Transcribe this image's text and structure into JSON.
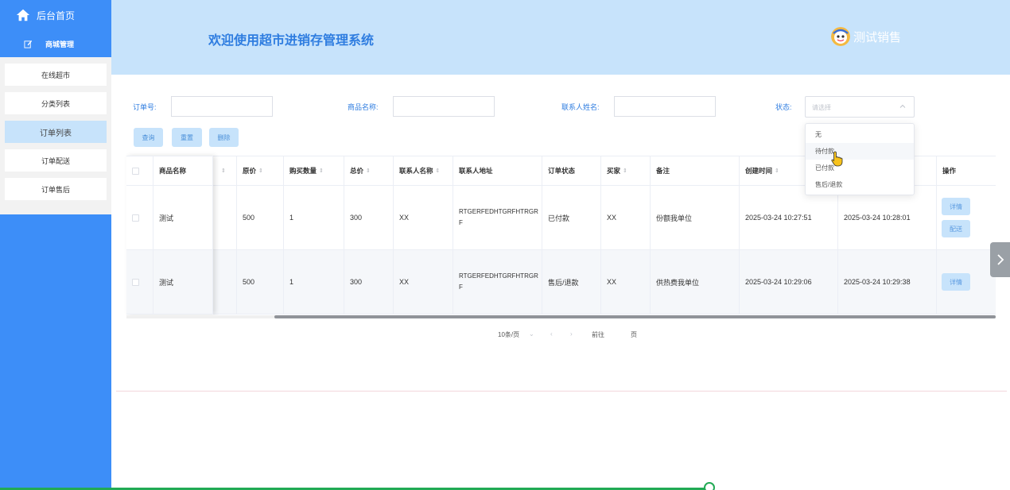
{
  "sidebar": {
    "home_label": "后台首页",
    "group_label": "商城管理",
    "items": [
      {
        "label": "在线超市"
      },
      {
        "label": "分类列表"
      },
      {
        "label": "订单列表"
      },
      {
        "label": "订单配送"
      },
      {
        "label": "订单售后"
      }
    ],
    "active_index": 2
  },
  "header": {
    "title": "欢迎使用超市进销存管理系统",
    "user_name": "测试销售"
  },
  "filters": {
    "order_no_label": "订单号:",
    "product_name_label": "商品名称:",
    "contact_name_label": "联系人姓名:",
    "status_label": "状态:",
    "status_placeholder": "请选择"
  },
  "buttons": {
    "query": "查询",
    "reset": "重置",
    "delete": "删除"
  },
  "table": {
    "columns": [
      "商品名称",
      "原价",
      "购买数量",
      "总价",
      "联系人名称",
      "联系人地址",
      "订单状态",
      "买家",
      "备注",
      "创建时间",
      "操作"
    ],
    "rows": [
      {
        "product": "测试",
        "price": "500",
        "qty": "1",
        "total": "300",
        "contact": "XX",
        "address": "RTGERFEDHTGRFHTRGRF",
        "status": "已付款",
        "buyer": "XX",
        "note": "份额我单位",
        "created": "2025-03-24 10:27:51",
        "updated": "2025-03-24 10:28:01",
        "ops": [
          "详情",
          "配送"
        ]
      },
      {
        "product": "测试",
        "price": "500",
        "qty": "1",
        "total": "300",
        "contact": "XX",
        "address": "RTGERFEDHTGRFHTRGRF",
        "status": "售后/退款",
        "buyer": "XX",
        "note": "供热费我单位",
        "created": "2025-03-24 10:29:06",
        "updated": "2025-03-24 10:29:38",
        "ops": [
          "详情"
        ]
      }
    ]
  },
  "pagination": {
    "page_size": "10条/页",
    "goto_label": "前往",
    "page_suffix": "页"
  },
  "status_dropdown": {
    "options": [
      "无",
      "待付款",
      "已付款",
      "售后/退款"
    ],
    "hover_index": 1
  },
  "colors": {
    "sidebar": "#3d8ef8",
    "header": "#c7e3fb",
    "accent": "#2f7de0"
  }
}
